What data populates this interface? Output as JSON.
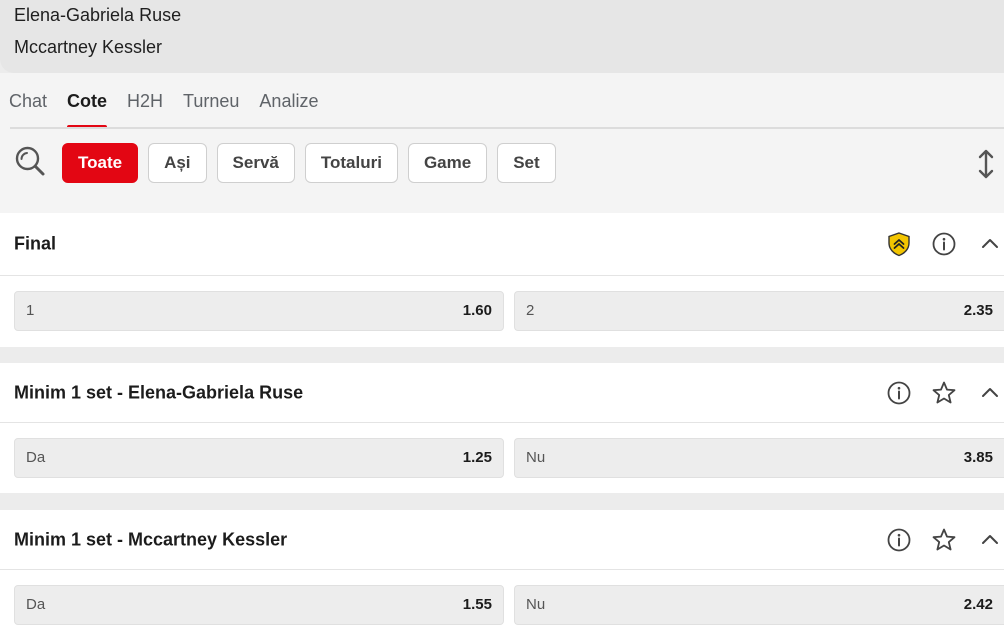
{
  "players": {
    "player1": "Elena-Gabriela Ruse",
    "player2": "Mccartney Kessler"
  },
  "tabs": [
    {
      "label": "Chat",
      "active": false
    },
    {
      "label": "Cote",
      "active": true
    },
    {
      "label": "H2H",
      "active": false
    },
    {
      "label": "Turneu",
      "active": false
    },
    {
      "label": "Analize",
      "active": false
    }
  ],
  "filters": [
    {
      "label": "Toate",
      "active": true
    },
    {
      "label": "Ași",
      "active": false
    },
    {
      "label": "Servă",
      "active": false
    },
    {
      "label": "Totaluri",
      "active": false
    },
    {
      "label": "Game",
      "active": false
    },
    {
      "label": "Set",
      "active": false
    }
  ],
  "icons": {
    "search": "search-icon",
    "sort": "sort-vertical-icon",
    "boost": "shield-boost-icon",
    "info": "info-icon",
    "star": "star-icon",
    "collapse": "chevron-up-icon"
  },
  "colors": {
    "accent": "#e30613",
    "boost_badge": "#f3c500"
  },
  "markets": [
    {
      "title": "Final",
      "has_boost": true,
      "odds": [
        {
          "label": "1",
          "value": "1.60"
        },
        {
          "label": "2",
          "value": "2.35"
        }
      ]
    },
    {
      "title": "Minim 1 set - Elena-Gabriela Ruse",
      "has_boost": false,
      "odds": [
        {
          "label": "Da",
          "value": "1.25"
        },
        {
          "label": "Nu",
          "value": "3.85"
        }
      ]
    },
    {
      "title": "Minim 1 set - Mccartney Kessler",
      "has_boost": false,
      "odds": [
        {
          "label": "Da",
          "value": "1.55"
        },
        {
          "label": "Nu",
          "value": "2.42"
        }
      ]
    }
  ]
}
